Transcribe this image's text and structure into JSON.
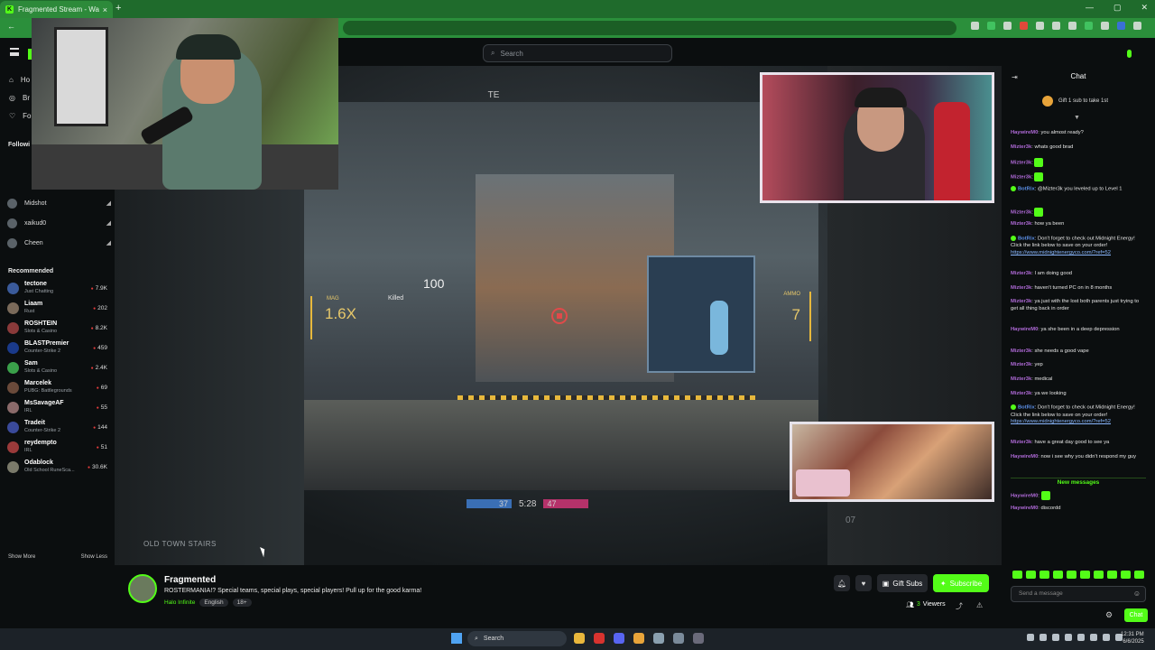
{
  "browser": {
    "tab_title": "Fragmented Stream - Watc",
    "tab_close": "×",
    "new_tab": "+",
    "window_controls": [
      "—",
      "▢",
      "✕"
    ]
  },
  "header": {
    "search_placeholder": "Search"
  },
  "sidebar": {
    "nav": [
      {
        "icon": "home-icon",
        "label": "Ho"
      },
      {
        "icon": "browse-icon",
        "label": "Br"
      },
      {
        "icon": "following-icon",
        "label": "Fo"
      }
    ],
    "following_label": "Followi",
    "following": [
      {
        "name": "Midshot"
      },
      {
        "name": "xaikud0"
      },
      {
        "name": "Cheen"
      }
    ],
    "recommended_label": "Recommended",
    "recommended": [
      {
        "name": "tectone",
        "category": "Just Chatting",
        "viewers": "7.9K",
        "color": "#3a5a9a"
      },
      {
        "name": "Liaam",
        "category": "Rust",
        "viewers": "202",
        "color": "#7a6a5a"
      },
      {
        "name": "ROSHTEIN",
        "category": "Slots & Casino",
        "viewers": "8.2K",
        "color": "#8a3a3a"
      },
      {
        "name": "BLASTPremier",
        "category": "Counter-Strike 2",
        "viewers": "459",
        "color": "#1a3a8a"
      },
      {
        "name": "Sam",
        "category": "Slots & Casino",
        "viewers": "2.4K",
        "color": "#3aa04a"
      },
      {
        "name": "Marcelek",
        "category": "PUBG: Battlegrounds",
        "viewers": "69",
        "color": "#6a4a3a"
      },
      {
        "name": "MsSavageAF",
        "category": "IRL",
        "viewers": "55",
        "color": "#8a6a6a"
      },
      {
        "name": "Tradeit",
        "category": "Counter-Strike 2",
        "viewers": "144",
        "color": "#3a4a9a"
      },
      {
        "name": "reydempto",
        "category": "IRL",
        "viewers": "51",
        "color": "#9a3a3a"
      },
      {
        "name": "Odablock",
        "category": "Old School RuneSca...",
        "viewers": "30.6K",
        "color": "#7a7a6a"
      }
    ],
    "show_more": "Show More",
    "show_less": "Show Less"
  },
  "video": {
    "hud_mag_label": "MAG",
    "hud_mag_value": "1.6X",
    "hud_ammo_label": "AMMO",
    "hud_ammo_value": "7",
    "hud_damage": "100",
    "hud_killed": "Killed",
    "score_left": "37",
    "score_time": "5:28",
    "score_right": "47",
    "location": "OLD TOWN STAIRS",
    "corner_num": "07",
    "sign_text": "TE"
  },
  "stream": {
    "streamer": "Fragmented",
    "title": "ROSTERMANIA!? Special teams, special plays, special players! Pull up for the good karma!",
    "category": "Halo Infinite",
    "tags": [
      "English",
      "18+"
    ],
    "gift_subs": "Gift Subs",
    "subscribe": "Subscribe",
    "viewers_count": "3",
    "viewers_label": "Viewers"
  },
  "chat": {
    "title": "Chat",
    "gift_banner": "Gift 1 sub to take 1st",
    "messages": [
      {
        "user": "HaywireM0",
        "text": "you almost ready?",
        "color": "purple"
      },
      {
        "user": "Mizter3k",
        "text": "whats good brad",
        "color": "purple"
      },
      {
        "user": "Mizter3k",
        "text": "",
        "color": "purple",
        "emote": true
      },
      {
        "user": "Mizter3k",
        "text": "",
        "color": "purple",
        "emote": true
      },
      {
        "user": "BotRix",
        "text": "@Mizter3k you leveled up to Level 1",
        "color": "blue",
        "bot": true
      },
      {
        "user": "Mizter3k",
        "text": "",
        "color": "purple",
        "emote": true
      },
      {
        "user": "Mizter3k",
        "text": "how ya been",
        "color": "purple"
      },
      {
        "user": "BotRix",
        "text": "Don't forget to check out Midnight Energy! Click the link below to save on your order!",
        "link": "https://www.midnightenergyco.com/?ref=52",
        "color": "blue",
        "bot": true
      },
      {
        "user": "Mizter3k",
        "text": "I am doing good",
        "color": "purple"
      },
      {
        "user": "Mizter3k",
        "text": "haven't turned PC on in 8 months",
        "color": "purple"
      },
      {
        "user": "Mizter3k",
        "text": "ya just with the lost both parents just trying to get all thing back in order",
        "color": "purple"
      },
      {
        "user": "HaywireM0",
        "text": "ya she been in a deep depression",
        "color": "purple"
      },
      {
        "user": "Mizter3k",
        "text": "she needs a good vape",
        "color": "purple"
      },
      {
        "user": "Mizter3k",
        "text": "yep",
        "color": "purple"
      },
      {
        "user": "Mizter3k",
        "text": "medical",
        "color": "purple"
      },
      {
        "user": "Mizter3k",
        "text": "ya we looking",
        "color": "purple"
      },
      {
        "user": "BotRix",
        "text": "Don't forget to check out Midnight Energy! Click the link below to save on your order!",
        "link": "https://www.midnightenergyco.com/?ref=52",
        "color": "blue",
        "bot": true
      },
      {
        "user": "Mizter3k",
        "text": "have a great day good to see ya",
        "color": "purple"
      },
      {
        "user": "HaywireM0",
        "text": "now i see why you didn't respond my guy",
        "color": "purple"
      }
    ],
    "new_messages_label": "New messages",
    "new_messages": [
      {
        "user": "HaywireM0",
        "text": "",
        "color": "purple",
        "emote": true
      },
      {
        "user": "HaywireM0",
        "text": "discordd",
        "color": "purple"
      }
    ],
    "input_placeholder": "Send a message",
    "send_label": "Chat"
  },
  "taskbar": {
    "search": "Search",
    "time": "12:31 PM",
    "date": "6/6/2025"
  }
}
